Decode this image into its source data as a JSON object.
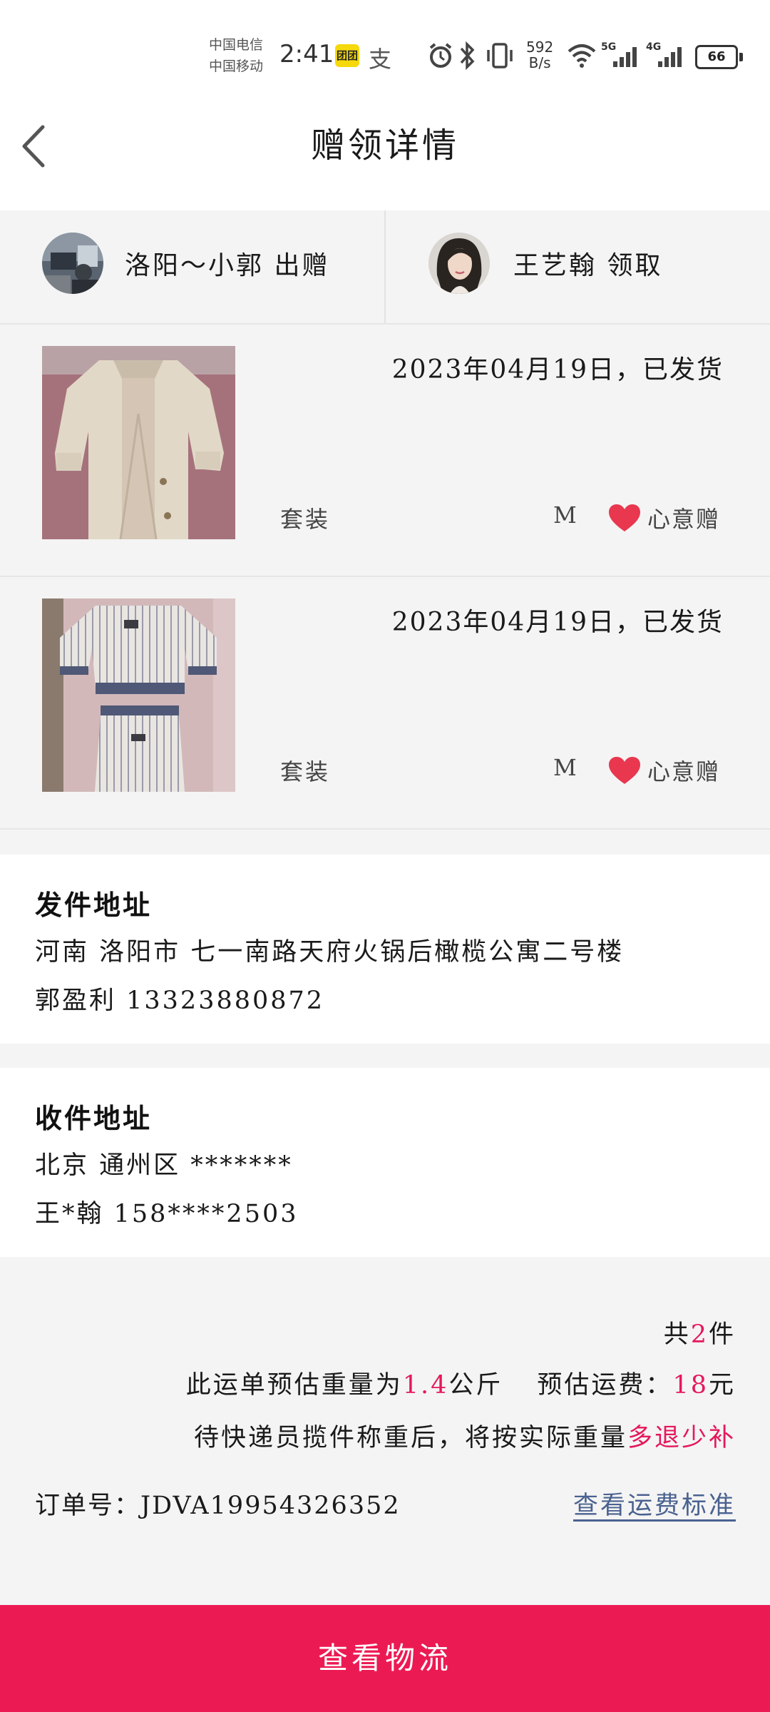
{
  "status_bar": {
    "carrier_1": "中国电信",
    "carrier_2": "中国移动",
    "time": "2:41",
    "app_badge": "团团",
    "alipay": "支",
    "speed_value": "592",
    "speed_unit": "B/s",
    "net_5g": "5G",
    "net_4g": "4G",
    "battery": "66"
  },
  "header": {
    "title": "赠领详情"
  },
  "users": {
    "giver": "洛阳～小郭 出赠",
    "receiver": "王艺翰 领取"
  },
  "items": [
    {
      "date": "2023年04月19日，已发货",
      "type": "套装",
      "size": "M",
      "gift": "心意赠"
    },
    {
      "date": "2023年04月19日，已发货",
      "type": "套装",
      "size": "M",
      "gift": "心意赠"
    }
  ],
  "sender": {
    "title": "发件地址",
    "address": "河南 洛阳市 七一南路天府火锅后橄榄公寓二号楼",
    "contact": "郭盈利 13323880872"
  },
  "receiver_address": {
    "title": "收件地址",
    "address": "北京 通州区 *******",
    "contact": "王*翰 158****2503"
  },
  "summary": {
    "count_prefix": "共",
    "count": "2",
    "count_suffix": "件",
    "weight_prefix": "此运单预估重量为",
    "weight": "1.4",
    "weight_unit": "公斤",
    "fee_label": "预估运费：",
    "fee": "18",
    "fee_unit": "元",
    "note_prefix": "待快递员揽件称重后，将按实际重量",
    "note_highlight": "多退少补",
    "order_label": "订单号：",
    "order_no": "JDVA19954326352",
    "fee_standard_link": "查看运费标准"
  },
  "action": {
    "logistics_button": "查看物流"
  },
  "colors": {
    "accent": "#ec1a53",
    "highlight": "#e5185a",
    "link": "#4a6290",
    "heart": "#e8374f"
  }
}
